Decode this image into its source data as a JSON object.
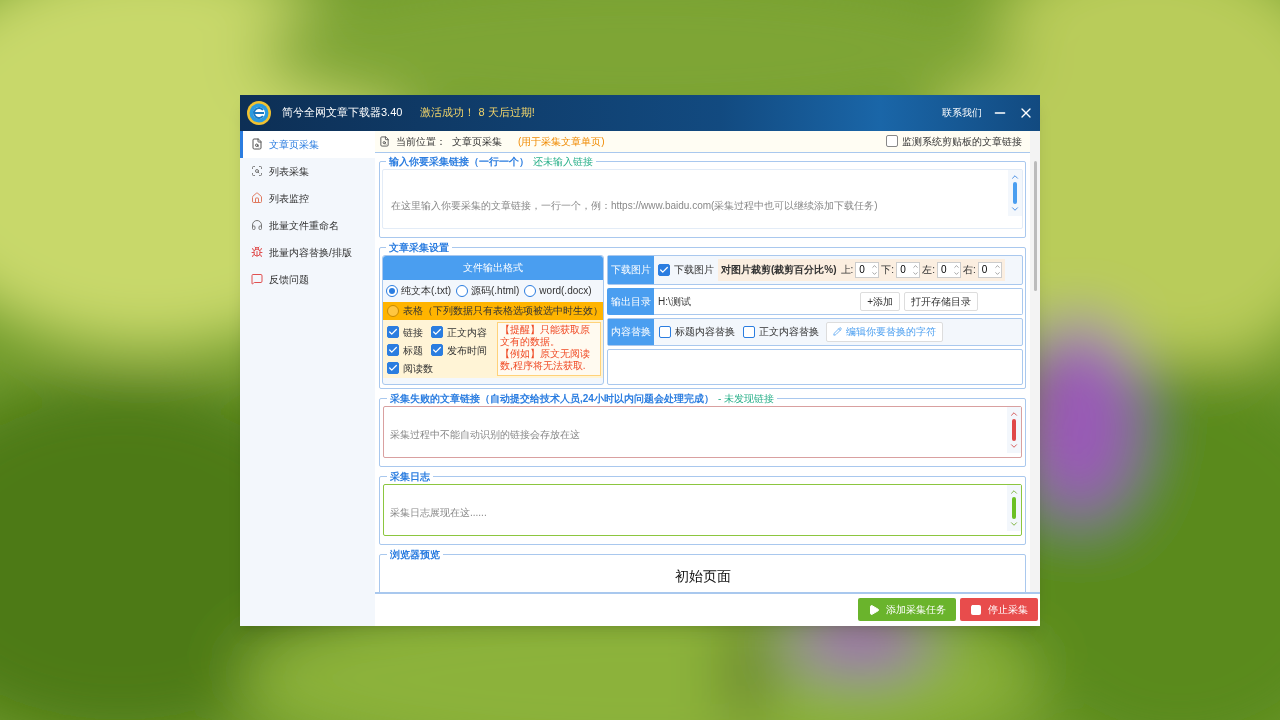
{
  "window": {
    "title": "简兮全网文章下载器3.40",
    "notice": "激活成功！ 8 天后过期!",
    "contact": "联系我们"
  },
  "sidebar": {
    "items": [
      {
        "label": "文章页采集",
        "selected": true
      },
      {
        "label": "列表采集",
        "selected": false
      },
      {
        "label": "列表监控",
        "selected": false
      },
      {
        "label": "批量文件重命名",
        "selected": false
      },
      {
        "label": "批量内容替换/排版",
        "selected": false
      },
      {
        "label": "反馈问题",
        "selected": false
      }
    ]
  },
  "breadcrumb": {
    "label": "当前位置：",
    "value": "文章页采集",
    "hint": "(用于采集文章单页)"
  },
  "monitor_clipboard": {
    "label": "监测系统剪贴板的文章链接",
    "checked": false
  },
  "url_input": {
    "legend": "输入你要采集链接（一行一个）",
    "status": "还未输入链接",
    "placeholder": "在这里输入你要采集的文章链接，一行一个，例：https://www.baidu.com(采集过程中也可以继续添加下载任务)"
  },
  "settings": {
    "legend": "文章采集设置",
    "format_header": "文件输出格式",
    "formats": [
      {
        "label": "纯文本(.txt)",
        "selected": true
      },
      {
        "label": "源码(.html)",
        "selected": false
      },
      {
        "label": "word(.docx)",
        "selected": false
      }
    ],
    "table_option": {
      "label": "表格（下列数据只有表格选项被选中时生效）",
      "selected": false
    },
    "fields": [
      {
        "label": "链接",
        "checked": true
      },
      {
        "label": "正文内容",
        "checked": true
      },
      {
        "label": "标题",
        "checked": true
      },
      {
        "label": "发布时间",
        "checked": true
      },
      {
        "label": "阅读数",
        "checked": true
      }
    ],
    "notes": [
      "【提醒】只能获取原文有的数据。",
      "【例如】原文无阅读数,程序将无法获取."
    ],
    "download_images": {
      "label": "下载图片",
      "checkbox": {
        "label": "下载图片",
        "checked": true
      },
      "crop_label": "对图片裁剪(裁剪百分比%)",
      "crops": [
        {
          "label": "上:",
          "value": "0"
        },
        {
          "label": "下:",
          "value": "0"
        },
        {
          "label": "左:",
          "value": "0"
        },
        {
          "label": "右:",
          "value": "0"
        }
      ]
    },
    "output_dir": {
      "label": "输出目录",
      "value": "H:\\测试",
      "buttons": [
        "+添加",
        "打开存储目录"
      ]
    },
    "replace": {
      "label": "内容替换",
      "options": [
        {
          "label": "标题内容替换",
          "checked": false
        },
        {
          "label": "正文内容替换",
          "checked": false
        }
      ],
      "edit_button": "编辑你要替换的字符"
    }
  },
  "failed_links": {
    "legend": "采集失败的文章链接（自动提交给技术人员,24小时以内问题会处理完成）",
    "status": "- 未发现链接",
    "placeholder": "采集过程中不能自动识别的链接会存放在这"
  },
  "log": {
    "legend": "采集日志",
    "placeholder": "采集日志展现在这......"
  },
  "preview": {
    "legend": "浏览器预览",
    "content": "初始页面"
  },
  "actions": [
    {
      "kind": "start",
      "label": "添加采集任务"
    },
    {
      "kind": "stop",
      "label": "停止采集"
    }
  ]
}
